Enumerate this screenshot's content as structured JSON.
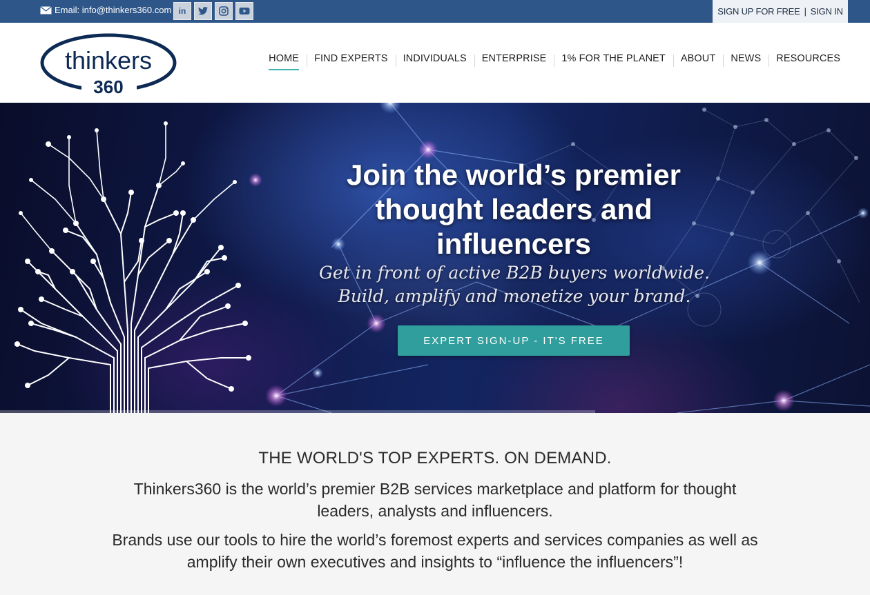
{
  "topbar": {
    "email": "Email: info@thinkers360.com",
    "socials": [
      {
        "name": "linkedin-icon",
        "glyph": "in"
      },
      {
        "name": "twitter-icon",
        "glyph": ""
      },
      {
        "name": "instagram-icon",
        "glyph": ""
      },
      {
        "name": "youtube-icon",
        "glyph": ""
      }
    ],
    "signup": "SIGN UP FOR FREE",
    "separator": "|",
    "signin": "SIGN IN"
  },
  "logo": {
    "word": "thinkers",
    "number": "360"
  },
  "nav": {
    "items": [
      "HOME",
      "FIND EXPERTS",
      "INDIVIDUALS",
      "ENTERPRISE",
      "1% FOR THE PLANET",
      "ABOUT",
      "NEWS",
      "RESOURCES"
    ],
    "active": "HOME"
  },
  "hero": {
    "title": "Join the world’s premier thought leaders and influencers",
    "subtitle": "Get in front of active B2B buyers worldwide. Build, amplify and monetize your brand.",
    "cta": "EXPERT SIGN-UP - IT'S FREE"
  },
  "intro": {
    "heading": "THE WORLD'S TOP EXPERTS. ON DEMAND.",
    "paragraph1": "Thinkers360 is the world’s premier B2B services marketplace and platform for thought leaders, analysts and influencers.",
    "paragraph2": "Brands use our tools to hire the world’s foremost experts and services companies as well as amplify their own executives and insights to “influence the influencers”!"
  },
  "colors": {
    "topbar": "#2e5689",
    "accent": "#2f9e9c",
    "logo": "#0d2a55"
  }
}
